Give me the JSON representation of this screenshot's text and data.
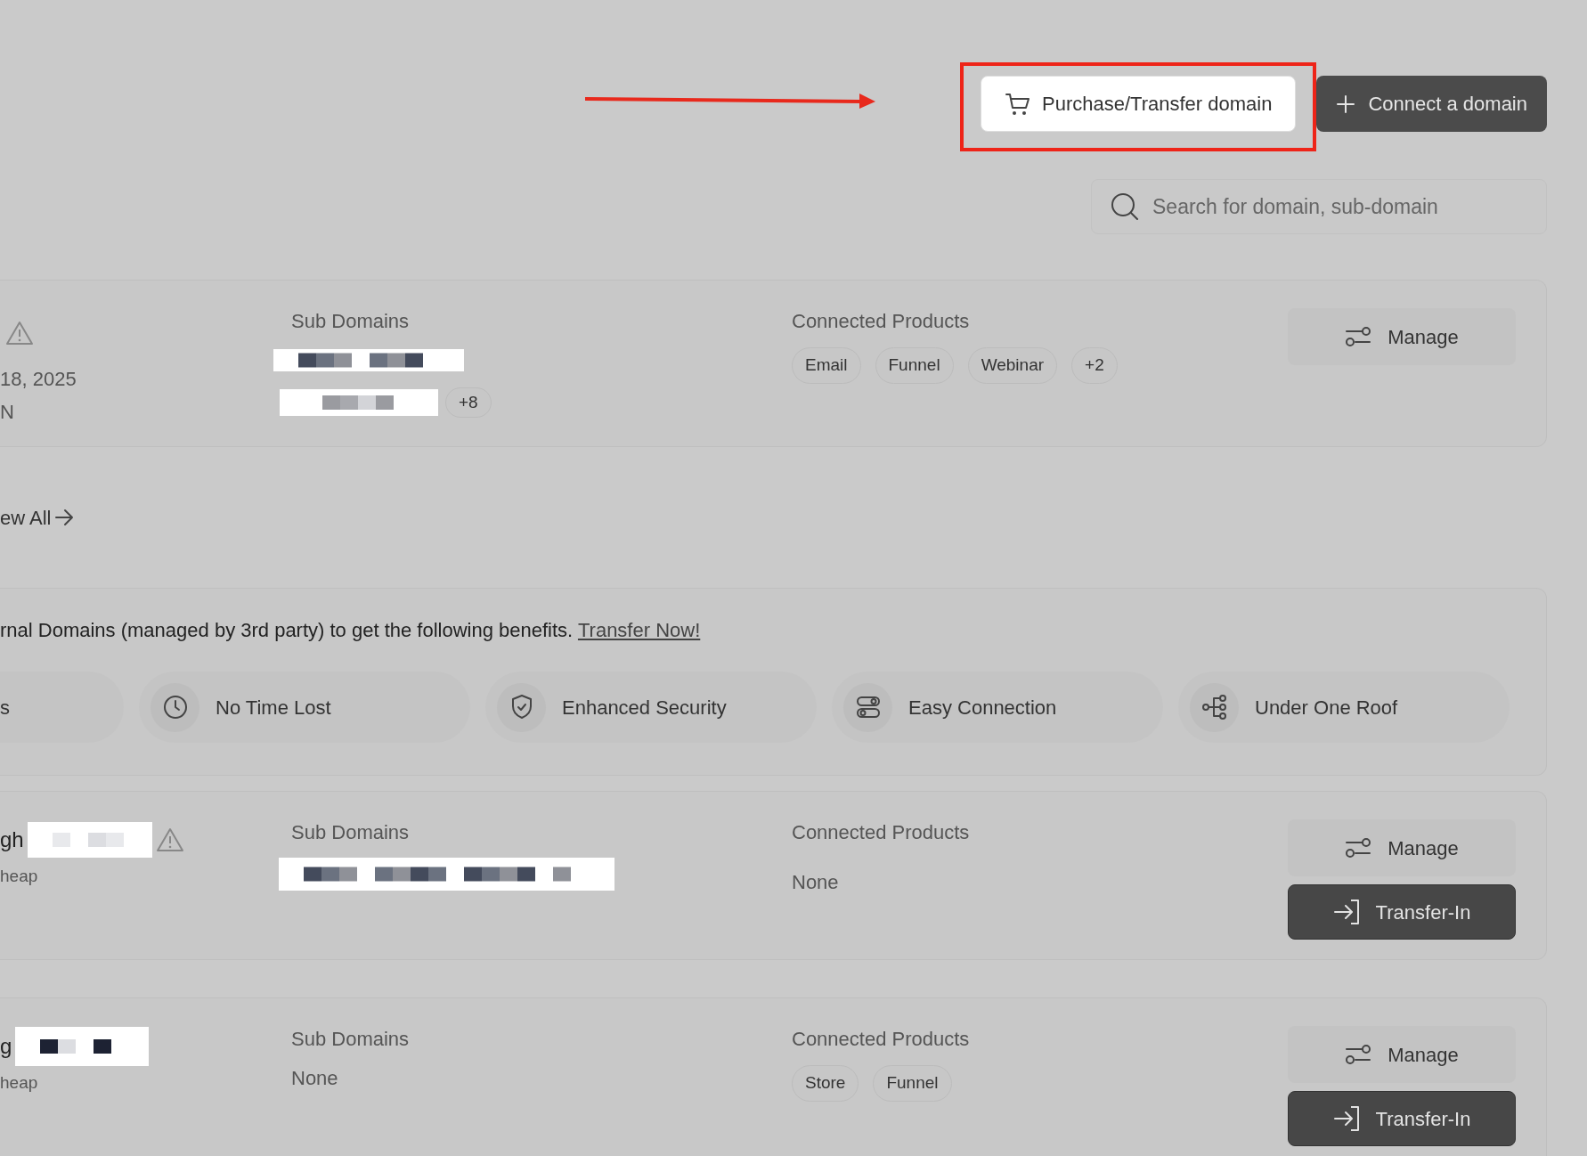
{
  "toolbar": {
    "purchase_button": {
      "label": "Purchase/Transfer domain",
      "highlighted": true
    },
    "connect_button": {
      "label": "Connect a domain"
    },
    "search": {
      "placeholder": "Search for domain, sub-domain"
    }
  },
  "domains_top": [
    {
      "name": {
        "warning": true
      },
      "details": [
        "18, 2025",
        "N"
      ],
      "sub_domains_label": "Sub Domains",
      "sub_domains": [
        {
          "kind": "redacted"
        },
        {
          "kind": "redacted",
          "more": "+8"
        }
      ],
      "products_label": "Connected Products",
      "products": [
        {
          "kind": "tag",
          "text": "Email"
        },
        {
          "kind": "tag",
          "text": "Funnel"
        },
        {
          "kind": "tag",
          "text": "Webinar"
        },
        {
          "kind": "tag",
          "text": "+2"
        }
      ],
      "buttons": [
        {
          "kind": "manage",
          "label": "Manage"
        }
      ]
    }
  ],
  "view_all": "ew All",
  "promo": {
    "text": "rnal Domains (managed by 3rd party) to get the following benefits.",
    "link": "Transfer Now!",
    "benefits": [
      {
        "kind": "partial",
        "label": "s"
      },
      {
        "kind": "clock",
        "label": "No Time Lost"
      },
      {
        "kind": "shield",
        "label": "Enhanced Security"
      },
      {
        "kind": "toggles",
        "label": "Easy Connection"
      },
      {
        "kind": "tree",
        "label": "Under One Roof"
      }
    ]
  },
  "domains_bottom": [
    {
      "name": {
        "text": "gh",
        "redacted": true,
        "warning": true
      },
      "details": [
        "heap"
      ],
      "sub_domains_label": "Sub Domains",
      "sub_domains": [
        {
          "kind": "redacted"
        }
      ],
      "products_label": "Connected Products",
      "products": [
        {
          "kind": "text",
          "text": "None"
        }
      ],
      "buttons": [
        {
          "kind": "manage",
          "label": "Manage"
        },
        {
          "kind": "transfer",
          "label": "Transfer-In"
        }
      ]
    },
    {
      "name": {
        "text": "g",
        "redacted": true,
        "warning": false
      },
      "details": [
        "heap"
      ],
      "sub_domains_label": "Sub Domains",
      "sub_domains": [
        {
          "kind": "text",
          "text": "None"
        }
      ],
      "products_label": "Connected Products",
      "products": [
        {
          "kind": "tag",
          "text": "Store"
        },
        {
          "kind": "tag",
          "text": "Funnel"
        }
      ],
      "buttons": [
        {
          "kind": "manage",
          "label": "Manage"
        },
        {
          "kind": "transfer",
          "label": "Transfer-In"
        }
      ]
    }
  ]
}
